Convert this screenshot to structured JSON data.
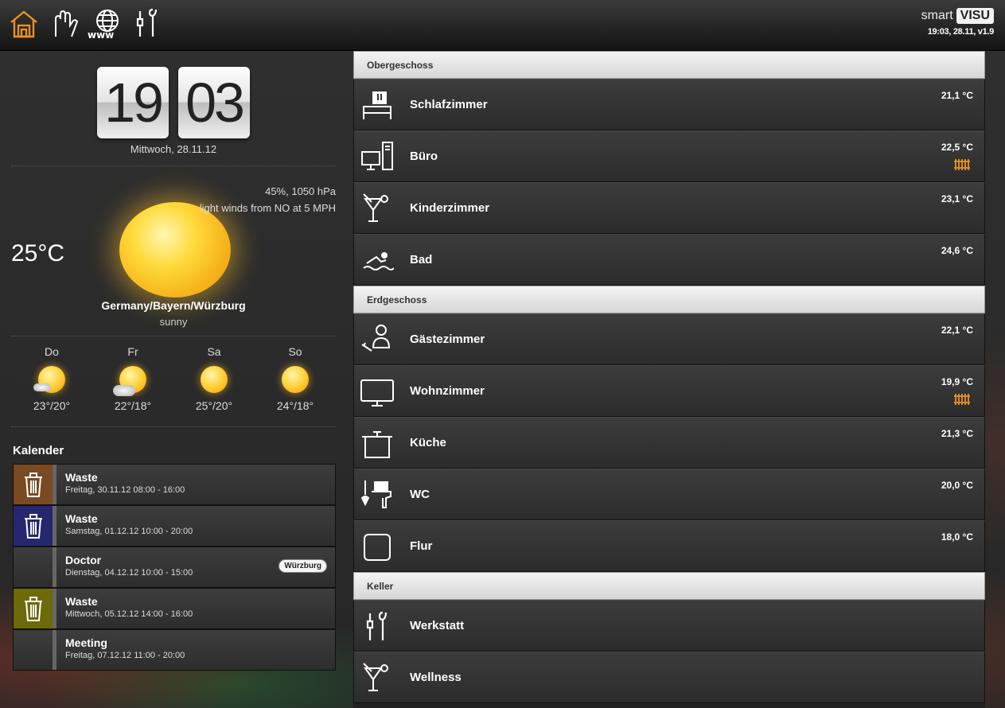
{
  "header": {
    "nav": [
      {
        "icon": "home-icon",
        "active": true
      },
      {
        "icon": "hand-icon"
      },
      {
        "icon": "www-globe-icon"
      },
      {
        "icon": "tools-icon"
      }
    ],
    "brand_smart": "smart",
    "brand_visu": "VISU",
    "meta": "19:03, 28.11, v1.9"
  },
  "clock": {
    "hour": "19",
    "minute": "03",
    "date": "Mittwoch, 28.11.12"
  },
  "weather": {
    "humidity_pressure": "45%, 1050 hPa",
    "wind": "light winds from NO at 5 MPH",
    "temperature": "25°C",
    "location": "Germany/Bayern/Würzburg",
    "condition": "sunny",
    "forecast": [
      {
        "day": "Do",
        "temp": "23°/20°",
        "icon": "sun-cloud-icon"
      },
      {
        "day": "Fr",
        "temp": "22°/18°",
        "icon": "sun-cloud-icon"
      },
      {
        "day": "Sa",
        "temp": "25°/20°",
        "icon": "sun-icon"
      },
      {
        "day": "So",
        "temp": "24°/18°",
        "icon": "sun-icon"
      }
    ]
  },
  "calendar": {
    "title": "Kalender",
    "items": [
      {
        "name": "Waste",
        "when": "Freitag, 30.11.12 08:00 - 16:00",
        "color": "#7a4a22",
        "icon": "trash-icon"
      },
      {
        "name": "Waste",
        "when": "Samstag, 01.12.12 10:00 - 20:00",
        "color": "#25286e",
        "icon": "trash-icon"
      },
      {
        "name": "Doctor",
        "when": "Dienstag, 04.12.12 10:00 - 15:00",
        "color": "",
        "icon": "",
        "badge": "Würzburg"
      },
      {
        "name": "Waste",
        "when": "Mittwoch, 05.12.12 14:00 - 16:00",
        "color": "#6d6a0a",
        "icon": "trash-icon"
      },
      {
        "name": "Meeting",
        "when": "Freitag, 07.12.12 11:00 - 20:00",
        "color": "",
        "icon": ""
      }
    ]
  },
  "rooms": {
    "obergeschoss": {
      "title": "Obergeschoss",
      "items": [
        {
          "name": "Schlafzimmer",
          "temp": "21,1 °C",
          "icon": "bed-icon",
          "heating": false
        },
        {
          "name": "Büro",
          "temp": "22,5 °C",
          "icon": "computer-icon",
          "heating": true
        },
        {
          "name": "Kinderzimmer",
          "temp": "23,1 °C",
          "icon": "cocktail-icon",
          "heating": false
        },
        {
          "name": "Bad",
          "temp": "24,6 °C",
          "icon": "swimming-icon",
          "heating": false
        }
      ]
    },
    "erdgeschoss": {
      "title": "Erdgeschoss",
      "items": [
        {
          "name": "Gästezimmer",
          "temp": "22,1 °C",
          "icon": "guest-icon",
          "heating": false
        },
        {
          "name": "Wohnzimmer",
          "temp": "19,9 °C",
          "icon": "tv-icon",
          "heating": true
        },
        {
          "name": "Küche",
          "temp": "21,3 °C",
          "icon": "pot-icon",
          "heating": false
        },
        {
          "name": "WC",
          "temp": "20,0 °C",
          "icon": "toilet-icon",
          "heating": false
        },
        {
          "name": "Flur",
          "temp": "18,0 °C",
          "icon": "room-icon",
          "heating": false
        }
      ]
    },
    "keller": {
      "title": "Keller",
      "items": [
        {
          "name": "Werkstatt",
          "temp": "",
          "icon": "tools-icon",
          "heating": false
        },
        {
          "name": "Wellness",
          "temp": "",
          "icon": "cocktail-icon",
          "heating": false
        }
      ]
    }
  },
  "colors": {
    "accent": "#e8922a"
  }
}
